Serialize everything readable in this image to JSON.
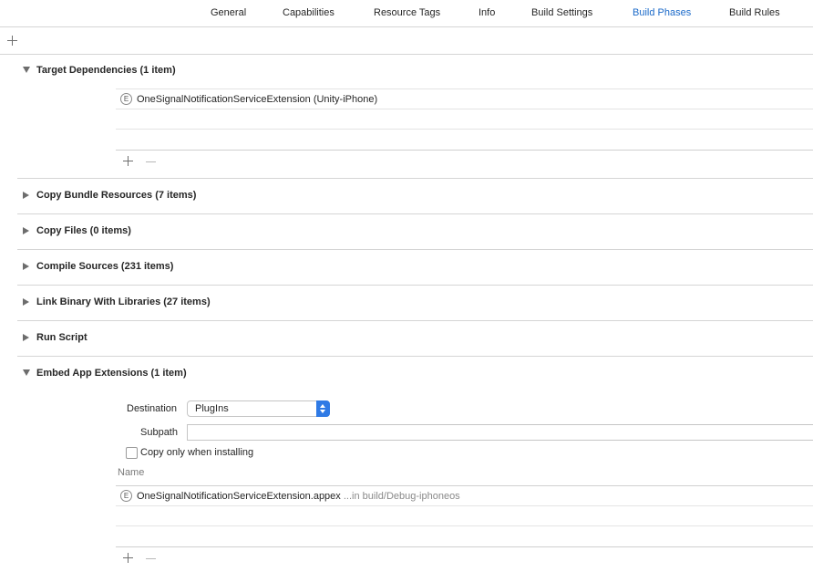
{
  "tabs": [
    {
      "label": "General"
    },
    {
      "label": "Capabilities"
    },
    {
      "label": "Resource Tags"
    },
    {
      "label": "Info"
    },
    {
      "label": "Build Settings"
    },
    {
      "label": "Build Phases"
    },
    {
      "label": "Build Rules"
    }
  ],
  "active_tab": "Build Phases",
  "accent_color": "#1b6ac9",
  "phases": {
    "target_dependencies": {
      "title": "Target Dependencies (1 item)",
      "expanded": true,
      "items": [
        {
          "icon": "E",
          "label": "OneSignalNotificationServiceExtension (Unity-iPhone)"
        }
      ]
    },
    "copy_bundle_resources": {
      "title": "Copy Bundle Resources (7 items)",
      "expanded": false
    },
    "copy_files": {
      "title": "Copy Files (0 items)",
      "expanded": false
    },
    "compile_sources": {
      "title": "Compile Sources (231 items)",
      "expanded": false
    },
    "link_binary": {
      "title": "Link Binary With Libraries (27 items)",
      "expanded": false
    },
    "run_script": {
      "title": "Run Script",
      "expanded": false
    },
    "embed_app_extensions": {
      "title": "Embed App Extensions (1 item)",
      "expanded": true,
      "destination_label": "Destination",
      "destination_value": "PlugIns",
      "subpath_label": "Subpath",
      "subpath_value": "",
      "copy_only_label": "Copy only when installing",
      "copy_only_checked": false,
      "column_header": "Name",
      "items": [
        {
          "icon": "E",
          "label": "OneSignalNotificationServiceExtension.appex",
          "path": "...in build/Debug-iphoneos"
        }
      ]
    }
  }
}
